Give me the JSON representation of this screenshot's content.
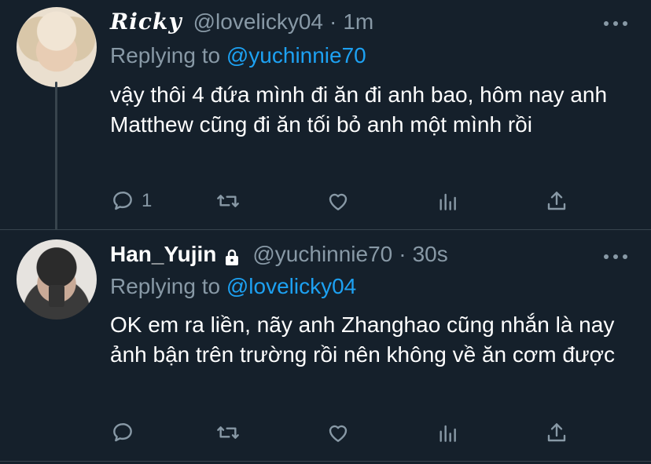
{
  "tweets": [
    {
      "display_name": "Ricky",
      "handle": "@lovelicky04",
      "separator": "·",
      "time": "1m",
      "replying_prefix": "Replying to",
      "replying_to": "@yuchinnie70",
      "text": "vậy thôi 4 đứa mình đi ăn đi anh bao, hôm nay anh Matthew cũng đi ăn tối bỏ anh một mình rồi",
      "reply_count": "1"
    },
    {
      "display_name": "Han_Yujin",
      "handle": "@yuchinnie70",
      "separator": "·",
      "time": "30s",
      "replying_prefix": "Replying to",
      "replying_to": "@lovelicky04",
      "text": "OK em ra liền, nãy anh Zhanghao cũng nhắn là nay ảnh bận trên trường rồi nên không về ăn cơm được",
      "reply_count": ""
    }
  ],
  "icons": {
    "reply": "reply-icon",
    "retweet": "retweet-icon",
    "like": "heart-icon",
    "stats": "analytics-icon",
    "share": "share-icon",
    "more": "more-icon",
    "lock": "lock-icon"
  },
  "colors": {
    "background": "#15202b",
    "secondary_text": "#8899a6",
    "accent": "#1da1f2",
    "divider": "#38444d"
  }
}
